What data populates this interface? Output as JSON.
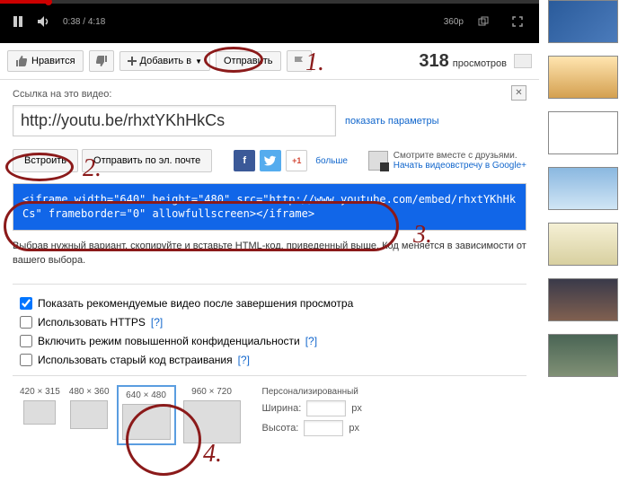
{
  "player": {
    "current_time": "0:38",
    "duration": "4:18",
    "quality": "360p"
  },
  "actions": {
    "like": "Нравится",
    "add": "Добавить в",
    "share": "Отправить",
    "views_num": "318",
    "views_label": "просмотров"
  },
  "share": {
    "label": "Ссылка на это видео:",
    "url": "http://youtu.be/rhxtYKhHkCs",
    "show_params": "показать параметры",
    "close": "✕"
  },
  "tabs": {
    "embed": "Встроить",
    "email": "Отправить по эл. почте",
    "more": "больше",
    "hangout_text": "Смотрите вместе с друзьями.",
    "hangout_link": "Начать видеовстречу в Google+"
  },
  "embed": {
    "code": "<iframe width=\"640\" height=\"480\" src=\"http://www.youtube.com/embed/rhxtYKhHkCs\" frameborder=\"0\" allowfullscreen></iframe>",
    "hint": "Выбрав нужный вариант, скопируйте и вставьте HTML-код, приведенный выше. Код меняется в зависимости от вашего выбора."
  },
  "options": {
    "recommend": "Показать рекомендуемые видео после завершения просмотра",
    "https": "Использовать HTTPS",
    "privacy": "Включить режим повышенной конфиденциальности",
    "oldcode": "Использовать старый код встраивания",
    "help": "[?]"
  },
  "sizes": {
    "s1": "420 × 315",
    "s2": "480 × 360",
    "s3": "640 × 480",
    "s4": "960 × 720",
    "custom_label": "Персонализированный",
    "width_label": "Ширина:",
    "height_label": "Высота:",
    "px": "px"
  },
  "anno": {
    "n1": "1.",
    "n2": "2.",
    "n3": "3.",
    "n4": "4."
  }
}
